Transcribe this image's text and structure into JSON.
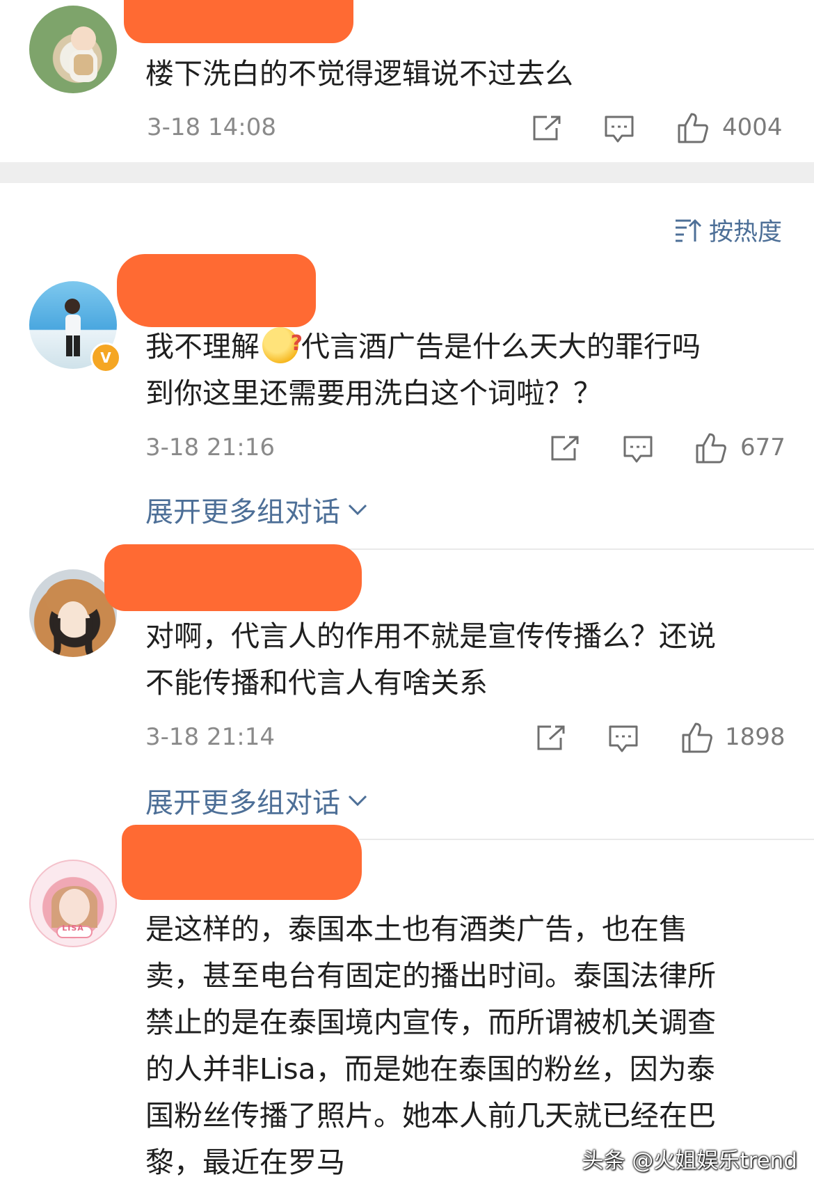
{
  "sort": {
    "label": "按热度"
  },
  "comments": [
    {
      "text": "楼下洗白的不觉得逻辑说不过去么",
      "time": "3-18 14:08",
      "likes": "4004"
    },
    {
      "text_before_emoji": "我不理解",
      "emoji": "thinking-face-emoji",
      "text_after_emoji": "代言酒广告是什么天大的罪行吗\n到你这里还需要用洗白这个词啦？？",
      "time": "3-18 21:16",
      "likes": "677",
      "expand_label": "展开更多组对话"
    },
    {
      "text": "对啊，代言人的作用不就是宣传传播么？还说\n不能传播和代言人有啥关系",
      "time": "3-18 21:14",
      "likes": "1898",
      "expand_label": "展开更多组对话"
    },
    {
      "text": "是这样的，泰国本土也有酒类广告，也在售\n卖，甚至电台有固定的播出时间。泰国法律所\n禁止的是在泰国境内宣传，而所谓被机关调查\n的人并非Lisa，而是她在泰国的粉丝，因为泰\n国粉丝传播了照片。她本人前几天就已经在巴\n黎，最近在罗马"
    }
  ],
  "avatar_badge": "V",
  "avatar_lettering": "LISA",
  "watermark": "头条 @火姐娱乐trend",
  "colors": {
    "link": "#4d6f97",
    "redaction": "#ff6a33",
    "meta": "#8a8a8a",
    "badge": "#f5a623"
  },
  "icons": [
    "share-icon",
    "comment-icon",
    "like-icon",
    "sort-icon",
    "chevron-down-icon"
  ]
}
